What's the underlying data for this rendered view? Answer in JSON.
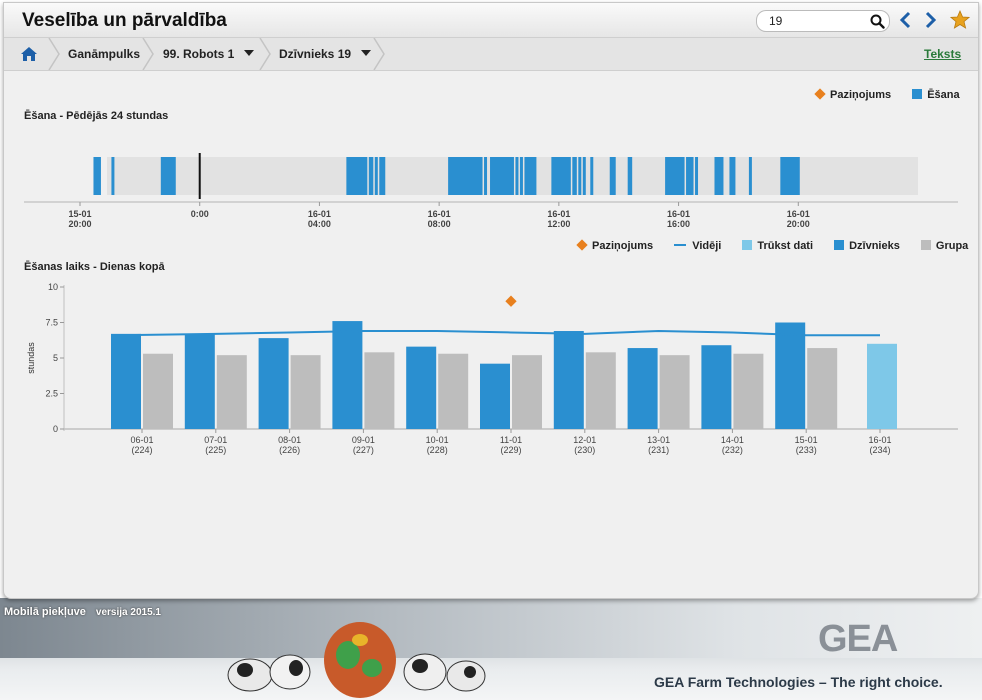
{
  "app_title": "Veselība un pārvaldība",
  "search": {
    "value": "19"
  },
  "breadcrumb": {
    "items": [
      "Ganāmpulks",
      "99. Robots 1",
      "Dzīvnieks 19"
    ],
    "text_link": "Teksts"
  },
  "chart1": {
    "title": "Ēšana - Pēdējās 24 stundas",
    "legend": [
      "Paziņojums",
      "Ēšana"
    ]
  },
  "chart2": {
    "title": "Ēšanas laiks - Dienas kopā",
    "ylabel": "stundas",
    "legend": [
      "Paziņojums",
      "Vidēji",
      "Trūkst dati",
      "Dzīvnieks",
      "Grupa"
    ]
  },
  "footer": {
    "mobile": "Mobilā piekļuve",
    "version": "versija 2015.1",
    "brand": "GEA",
    "slogan": "GEA Farm Technologies – The right choice."
  },
  "colors": {
    "animal": "#2a8fd0",
    "group": "#bdbdbd",
    "missing": "#7ec8e8",
    "notice": "#e8801e",
    "average": "#2a8fd0"
  },
  "chart_data": [
    {
      "type": "timeline",
      "title": "Ēšana - Pēdējās 24 stundas",
      "x_range_hours": [
        -4,
        24
      ],
      "ticks": [
        {
          "hour": -4,
          "l1": "15-01",
          "l2": "20:00"
        },
        {
          "hour": 0,
          "l1": "0:00",
          "l2": ""
        },
        {
          "hour": 4,
          "l1": "16-01",
          "l2": "04:00"
        },
        {
          "hour": 8,
          "l1": "16-01",
          "l2": "08:00"
        },
        {
          "hour": 12,
          "l1": "16-01",
          "l2": "12:00"
        },
        {
          "hour": 16,
          "l1": "16-01",
          "l2": "16:00"
        },
        {
          "hour": 20,
          "l1": "16-01",
          "l2": "20:00"
        }
      ],
      "no_data_until_hour": -3.1,
      "marker_hour": 0,
      "eating_intervals": [
        [
          -3.55,
          -3.3
        ],
        [
          -2.95,
          -2.85
        ],
        [
          -1.3,
          -0.8
        ],
        [
          4.9,
          5.6
        ],
        [
          5.65,
          5.8
        ],
        [
          5.85,
          5.95
        ],
        [
          6.0,
          6.2
        ],
        [
          8.3,
          9.45
        ],
        [
          9.5,
          9.6
        ],
        [
          9.7,
          10.5
        ],
        [
          10.55,
          10.65
        ],
        [
          10.7,
          10.8
        ],
        [
          10.85,
          11.25
        ],
        [
          11.75,
          12.4
        ],
        [
          12.45,
          12.6
        ],
        [
          12.65,
          12.75
        ],
        [
          12.8,
          12.9
        ],
        [
          13.05,
          13.15
        ],
        [
          13.7,
          13.9
        ],
        [
          14.3,
          14.45
        ],
        [
          15.55,
          16.2
        ],
        [
          16.25,
          16.5
        ],
        [
          16.55,
          16.65
        ],
        [
          17.2,
          17.5
        ],
        [
          17.7,
          17.9
        ],
        [
          18.35,
          18.45
        ],
        [
          19.4,
          20.05
        ]
      ]
    },
    {
      "type": "bar",
      "title": "Ēšanas laiks - Dienas kopā",
      "ylabel": "stundas",
      "ylim": [
        0,
        10
      ],
      "yticks": [
        "0",
        "2.5",
        "5",
        "7.5",
        "10"
      ],
      "categories": [
        "06-01",
        "07-01",
        "08-01",
        "09-01",
        "10-01",
        "11-01",
        "12-01",
        "13-01",
        "14-01",
        "15-01",
        "16-01"
      ],
      "category_days": [
        "(224)",
        "(225)",
        "(226)",
        "(227)",
        "(228)",
        "(229)",
        "(230)",
        "(231)",
        "(232)",
        "(233)",
        "(234)"
      ],
      "series": [
        {
          "name": "Dzīvnieks",
          "values": [
            6.7,
            6.7,
            6.4,
            7.6,
            5.8,
            4.6,
            6.9,
            5.7,
            5.9,
            7.5,
            null
          ]
        },
        {
          "name": "Grupa",
          "values": [
            5.3,
            5.2,
            5.2,
            5.4,
            5.3,
            5.2,
            5.4,
            5.2,
            5.3,
            5.7,
            null
          ]
        },
        {
          "name": "Trūkst dati",
          "values": [
            null,
            null,
            null,
            null,
            null,
            null,
            null,
            null,
            null,
            null,
            6.0
          ]
        },
        {
          "name": "Vidēji",
          "values": [
            6.6,
            6.7,
            6.8,
            6.9,
            6.9,
            6.8,
            6.7,
            6.9,
            6.8,
            6.6,
            6.6
          ]
        }
      ],
      "notices": [
        {
          "category": "11-01",
          "y": 9.0
        }
      ]
    }
  ]
}
